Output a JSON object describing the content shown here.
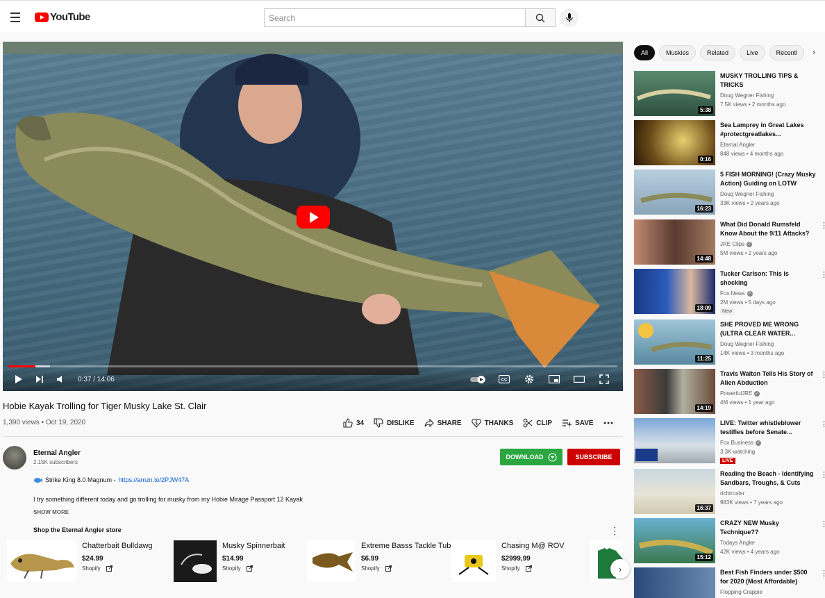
{
  "header": {
    "logo_text": "YouTube",
    "search_placeholder": "Search"
  },
  "player": {
    "time": "0:37 / 14:06",
    "progress_fraction": 0.044
  },
  "video": {
    "title": "Hobie Kayak Trolling for Tiger Musky Lake St. Clair",
    "meta": "1,390 views • Oct 19, 2020",
    "likes": "34",
    "dislike": "DISLIKE",
    "share": "SHARE",
    "thanks": "THANKS",
    "clip": "CLIP",
    "save": "SAVE"
  },
  "channel": {
    "name": "Eternal Angler",
    "subscribers": "2.15K subscribers",
    "download": "DOWNLOAD",
    "subscribe": "SUBSCRIBE"
  },
  "description": {
    "link_label": "Strike King 8.0 Magnum - ",
    "link_url": "https://amzn.to/2PJW47A",
    "text": "I try something different today and go trolling for musky from my Hobie Mirage Passport 12 Kayak",
    "show_more": "SHOW MORE"
  },
  "store": {
    "title": "Shop the Eternal Angler store",
    "items": [
      {
        "name": "Chatterbait Bulldawg",
        "price": "$24.99",
        "source": "Shopify"
      },
      {
        "name": "Musky Spinnerbait",
        "price": "$14.99",
        "source": "Shopify"
      },
      {
        "name": "Extreme Basss Tackle Tube",
        "price": "$6.99",
        "source": "Shopify"
      },
      {
        "name": "Chasing M@ ROV",
        "price": "$2999,99",
        "source": "Shopify"
      }
    ]
  },
  "chips": [
    "All",
    "Muskies",
    "Related",
    "Live",
    "Recentl"
  ],
  "recommendations": [
    {
      "title": "MUSKY TROLLING TIPS & TRICKS",
      "channel": "Doug Wegner Fishing",
      "stats": "7.5K views • 2 months ago",
      "duration": "5:38",
      "verified": false,
      "badge": ""
    },
    {
      "title": "Sea Lamprey in Great Lakes #protectgreatlakes...",
      "channel": "Eternal Angler",
      "stats": "848 views • 4 months ago",
      "duration": "0:16",
      "verified": false,
      "badge": ""
    },
    {
      "title": "5 FISH MORNING! (Crazy Musky Action) Guiding on LOTW",
      "channel": "Doug Wegner Fishing",
      "stats": "33K views • 2 years ago",
      "duration": "16:23",
      "verified": false,
      "badge": ""
    },
    {
      "title": "What Did Donald Rumsfeld Know About the 9/11 Attacks?",
      "channel": "JRE Clips",
      "stats": "5M views • 2 years ago",
      "duration": "14:48",
      "verified": true,
      "badge": ""
    },
    {
      "title": "Tucker Carlson: This is shocking",
      "channel": "Fox News",
      "stats": "2M views • 5 days ago",
      "duration": "18:09",
      "verified": true,
      "badge": "New"
    },
    {
      "title": "SHE PROVED ME WRONG (ULTRA CLEAR WATER...",
      "channel": "Doug Wegner Fishing",
      "stats": "14K views • 3 months ago",
      "duration": "11:25",
      "verified": false,
      "badge": ""
    },
    {
      "title": "Travis Walton Tells His Story of Alien Abduction",
      "channel": "PowerfulJRE",
      "stats": "4M views • 1 year ago",
      "duration": "14:19",
      "verified": true,
      "badge": ""
    },
    {
      "title": "LIVE: Twitter whistleblower testifies before Senate...",
      "channel": "Fox Business",
      "stats": "3.3K watching",
      "duration": "",
      "verified": true,
      "badge": "LIVE"
    },
    {
      "title": "Reading the Beach - Identifying Sandbars, Troughs, & Cuts",
      "channel": "richtroxler",
      "stats": "983K views • 7 years ago",
      "duration": "16:37",
      "verified": false,
      "badge": ""
    },
    {
      "title": "CRAZY NEW Musky Technique??",
      "channel": "Todays Angler",
      "stats": "42K views • 4 years ago",
      "duration": "15:12",
      "verified": false,
      "badge": ""
    },
    {
      "title": "Best Fish Finders under $500 for 2020 (Most Affordable)",
      "channel": "Flopping Crappie",
      "stats": "",
      "duration": "",
      "verified": false,
      "badge": ""
    }
  ],
  "colors": {
    "brand_red": "#ff0000",
    "subscribe_red": "#cc0000",
    "download_green": "#2ba640",
    "link_blue": "#065fd4"
  }
}
